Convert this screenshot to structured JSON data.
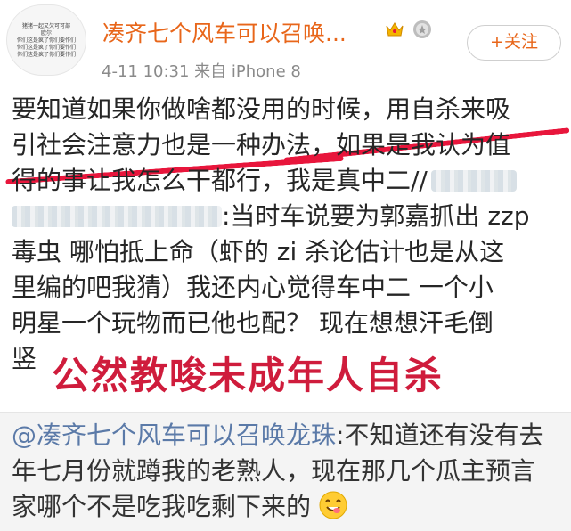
{
  "post": {
    "avatar_text": [
      "猪猪一起又欠可可部",
      "欧尔",
      "你们这是疯了你们要作们",
      "你们这是疯了你们要作们",
      "你们这是疯了你们要作们"
    ],
    "username": "凑齐七个风车可以召唤...",
    "follow_label": "+关注",
    "meta": "4-11 10:31  来自 iPhone 8",
    "body_lines": [
      "要知道如果你做啥都没用的时候，用自杀来吸",
      "引社会注意力也是一种办法，如果是我认为值",
      "得的事让我怎么干都行，我是真中二//"
    ],
    "line4_suffix": ":当时车说要为郭嘉抓出 zzp",
    "body_lines_2": [
      "毒虫 哪怕抵上命（虾的 zi 杀论估计也是从这",
      "里编的吧我猜）我还内心觉得车中二 一个小",
      "明星一个玩物而已他也配？ 现在想想汗毛倒",
      "竖"
    ],
    "stamp": "公然教唆未成年人自杀"
  },
  "repost": {
    "mention": "@凑齐七个风车可以召唤龙珠",
    "line1_suffix": ":不知道还有没有去",
    "line2": "年七月份就蹲我的老熟人，现在那几个瓜主预言",
    "line3": "家哪个不是吃我吃剩下来的"
  },
  "colors": {
    "accent": "#e8661a",
    "mention": "#5b7aa8",
    "highlight": "#e8163c",
    "stamp": "#cf1c3c"
  },
  "icons": [
    "crown-icon",
    "medal-icon",
    "yummy-face-emoji-icon"
  ]
}
